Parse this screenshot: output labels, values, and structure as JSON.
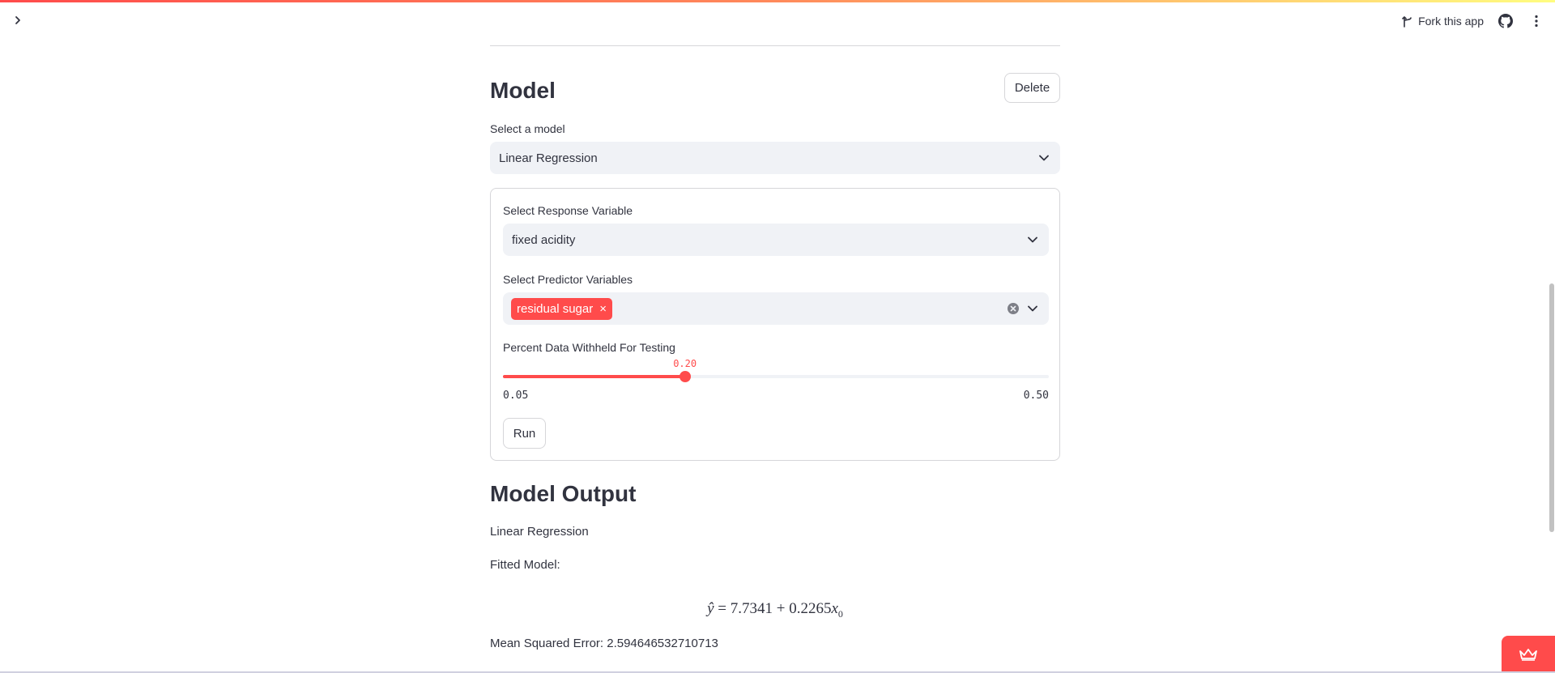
{
  "header": {
    "fork_label": "Fork this app",
    "sidebar_toggle_icon": "chevron-right-icon",
    "github_icon": "github-icon",
    "menu_icon": "kebab-menu-icon"
  },
  "model_section": {
    "title": "Model",
    "delete_label": "Delete",
    "select_model_label": "Select a model",
    "selected_model": "Linear Regression"
  },
  "form": {
    "response_label": "Select Response Variable",
    "response_value": "fixed acidity",
    "predictor_label": "Select Predictor Variables",
    "predictor_tags": [
      "residual sugar"
    ],
    "slider_label": "Percent Data Withheld For Testing",
    "slider": {
      "min": 0.05,
      "max": 0.5,
      "value": 0.2,
      "min_label": "0.05",
      "max_label": "0.50",
      "value_label": "0.20"
    },
    "run_label": "Run"
  },
  "output": {
    "title": "Model Output",
    "model_name": "Linear Regression",
    "fitted_label": "Fitted Model:",
    "equation": {
      "lhs": "ŷ",
      "intercept": "7.7341",
      "coef": "0.2265",
      "var": "x",
      "sub": "0"
    },
    "mse_text": "Mean Squared Error: 2.594646532710713"
  },
  "colors": {
    "accent": "#ff4b4b",
    "input_bg": "#f0f2f6",
    "text": "#31333f",
    "border": "#d6d6d9"
  }
}
